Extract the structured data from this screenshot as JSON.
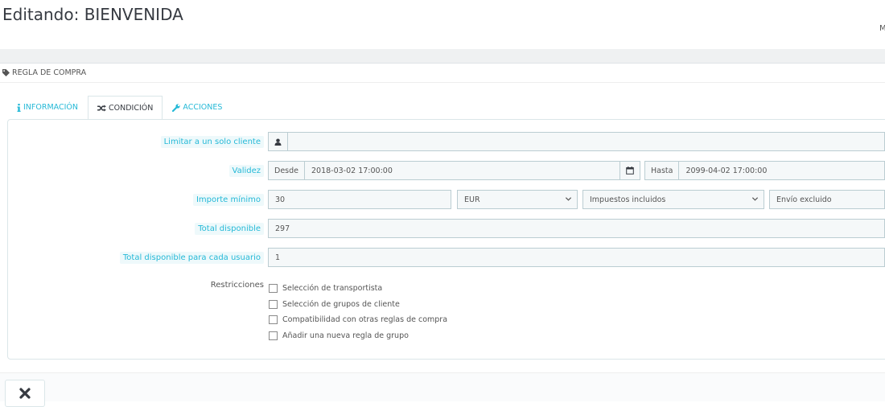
{
  "page": {
    "title": "Editando: BIENVENIDA",
    "top_right_text": "M"
  },
  "panel": {
    "header": "REGLA DE COMPRA",
    "header_icon": "tag-icon"
  },
  "tabs": [
    {
      "label": "INFORMACIÓN",
      "icon": "info-icon",
      "active": false
    },
    {
      "label": "CONDICIÓN",
      "icon": "random-icon",
      "active": true
    },
    {
      "label": "ACCIONES",
      "icon": "wrench-icon",
      "active": false
    }
  ],
  "form": {
    "customer": {
      "label": "Limitar a un solo cliente",
      "value": "",
      "icon": "user-icon"
    },
    "validity": {
      "label": "Validez",
      "from_label": "Desde",
      "from_value": "2018-03-02 17:00:00",
      "to_label": "Hasta",
      "to_value": "2099-04-02 17:00:00",
      "calendar_icon": "calendar-icon"
    },
    "minimum": {
      "label": "Importe mínimo",
      "amount": "30",
      "currency": "EUR",
      "tax": "Impuestos incluidos",
      "shipping": "Envío excluido"
    },
    "total_available": {
      "label": "Total disponible",
      "value": "297"
    },
    "total_per_user": {
      "label": "Total disponible para cada usuario",
      "value": "1"
    },
    "restrictions": {
      "label": "Restricciones",
      "options": [
        {
          "label": "Selección de transportista",
          "checked": false
        },
        {
          "label": "Selección de grupos de cliente",
          "checked": false
        },
        {
          "label": "Compatibilidad con otras reglas de compra",
          "checked": false
        },
        {
          "label": "Añadir una nueva regla de grupo",
          "checked": false
        }
      ]
    }
  },
  "footer": {
    "cancel_icon": "close-icon"
  },
  "colors": {
    "accent": "#25b9d7",
    "border": "#bbcdd2",
    "input_bg": "#f5f8f9",
    "text": "#555555"
  }
}
